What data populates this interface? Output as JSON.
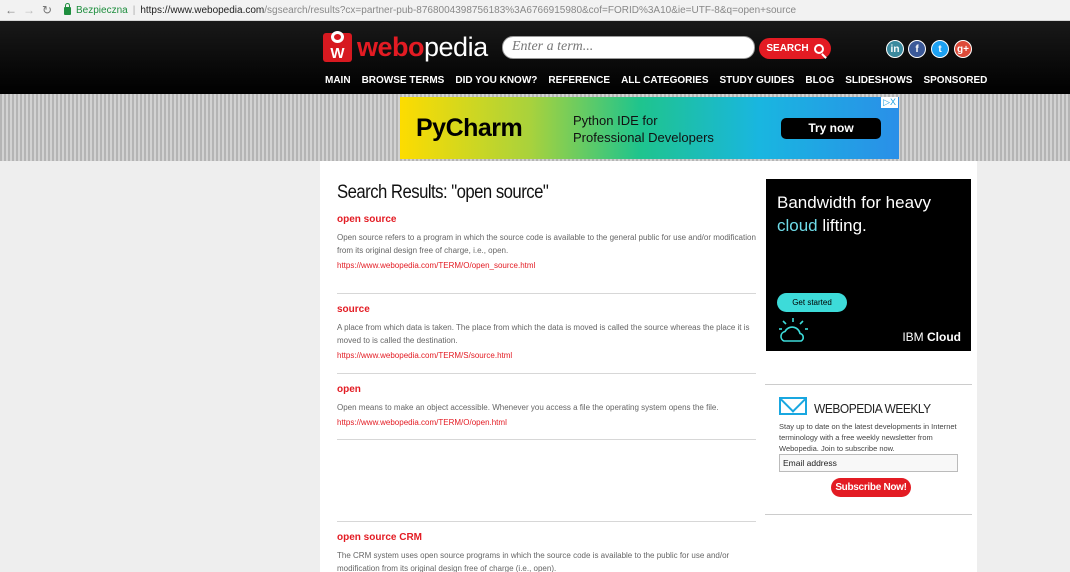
{
  "browser": {
    "secure_label": "Bezpieczna",
    "url_host": "https://www.webopedia.com",
    "url_path": "/sgsearch/results?cx=partner-pub-8768004398756183%3A6766915980&cof=FORID%3A10&ie=UTF-8&q=open+source"
  },
  "header": {
    "logo_part1": "webo",
    "logo_part2": "pedia",
    "search_placeholder": "Enter a term...",
    "search_button": "SEARCH",
    "social": [
      "in",
      "f",
      "t",
      "g+"
    ],
    "nav": [
      "MAIN",
      "BROWSE TERMS",
      "DID YOU KNOW?",
      "REFERENCE",
      "ALL CATEGORIES",
      "STUDY GUIDES",
      "BLOG",
      "SLIDESHOWS",
      "SPONSORED"
    ]
  },
  "banner_ad": {
    "title": "PyCharm",
    "subtitle_line1": "Python IDE for",
    "subtitle_line2": "Professional Developers",
    "cta": "Try now",
    "badge": "▷X"
  },
  "main": {
    "title": "Search Results: \"open source\"",
    "results": [
      {
        "title": "open source",
        "desc": "Open source refers to a program in which the source code is available to the general public for use and/or modification from its original design free of charge, i.e., open.",
        "url": "https://www.webopedia.com/TERM/O/open_source.html"
      },
      {
        "title": "source",
        "desc": "A place from which data is taken. The place from which the data is moved is called the source whereas the place it is moved to is called the destination.",
        "url": "https://www.webopedia.com/TERM/S/source.html"
      },
      {
        "title": "open",
        "desc": "Open means to make an object accessible. Whenever you access a file the operating system opens the file.",
        "url": "https://www.webopedia.com/TERM/O/open.html"
      },
      {
        "title": "open source CRM",
        "desc": "The CRM system uses open source programs in which the source code is available to the public for use and/or modification from its original design free of charge (i.e., open).",
        "url": ""
      }
    ]
  },
  "sidebar": {
    "ibm_ad": {
      "headline_line1": "Bandwidth for heavy",
      "headline_cloud": "cloud",
      "headline_rest": " lifting.",
      "button": "Get started",
      "brand_a": "IBM ",
      "brand_b": "Cloud"
    },
    "newsletter": {
      "title": "WEBOPEDIA WEEKLY",
      "text": "Stay up to date on the latest developments in Internet terminology with a free weekly newsletter from Webopedia. Join to subscribe now.",
      "email_placeholder": "Email address",
      "button": "Subscribe Now!"
    }
  }
}
